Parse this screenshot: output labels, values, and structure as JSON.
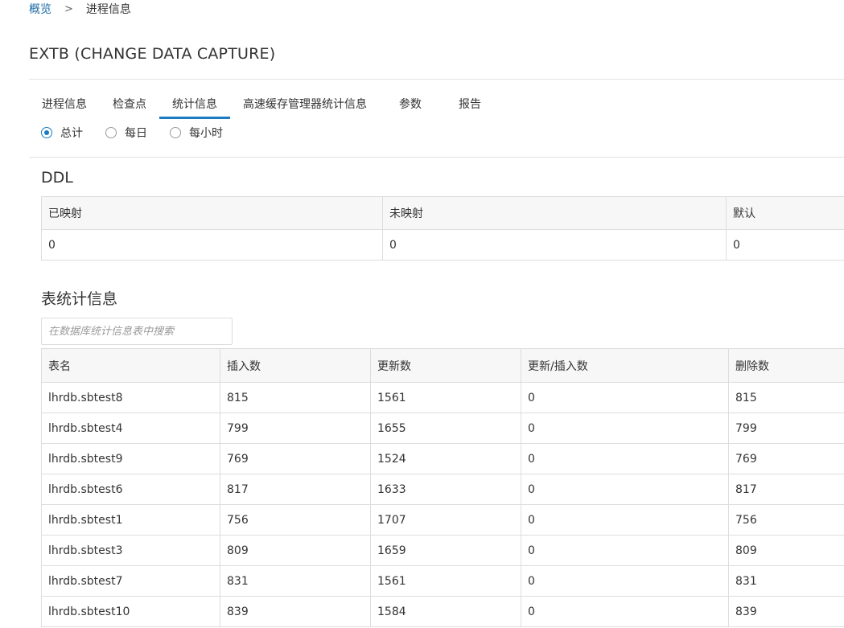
{
  "breadcrumb": {
    "home": "概览",
    "separator": ">",
    "current": "进程信息"
  },
  "page": {
    "title": "EXTB (CHANGE DATA CAPTURE)"
  },
  "tabs": [
    {
      "label": "进程信息"
    },
    {
      "label": "检查点"
    },
    {
      "label": "统计信息"
    },
    {
      "label": "高速缓存管理器统计信息"
    },
    {
      "label": "参数"
    },
    {
      "label": "报告"
    }
  ],
  "active_tab": "统计信息",
  "radios": [
    {
      "label": "总计",
      "checked": true
    },
    {
      "label": "每日",
      "checked": false
    },
    {
      "label": "每小时",
      "checked": false
    }
  ],
  "ddl": {
    "title": "DDL",
    "headers": [
      "已映射",
      "未映射",
      "默认"
    ],
    "row": [
      "0",
      "0",
      "0"
    ]
  },
  "table_stats": {
    "title": "表统计信息",
    "search_placeholder": "在数据库统计信息表中搜索",
    "headers": [
      "表名",
      "插入数",
      "更新数",
      "更新/插入数",
      "删除数"
    ],
    "rows": [
      [
        "lhrdb.sbtest8",
        "815",
        "1561",
        "0",
        "815"
      ],
      [
        "lhrdb.sbtest4",
        "799",
        "1655",
        "0",
        "799"
      ],
      [
        "lhrdb.sbtest9",
        "769",
        "1524",
        "0",
        "769"
      ],
      [
        "lhrdb.sbtest6",
        "817",
        "1633",
        "0",
        "817"
      ],
      [
        "lhrdb.sbtest1",
        "756",
        "1707",
        "0",
        "756"
      ],
      [
        "lhrdb.sbtest3",
        "809",
        "1659",
        "0",
        "809"
      ],
      [
        "lhrdb.sbtest7",
        "831",
        "1561",
        "0",
        "831"
      ],
      [
        "lhrdb.sbtest10",
        "839",
        "1584",
        "0",
        "839"
      ]
    ]
  },
  "colors": {
    "accent": "#1a7bc1",
    "link": "#1a6aa7",
    "header_bg": "#f7f7f7",
    "border": "#dddddd"
  }
}
